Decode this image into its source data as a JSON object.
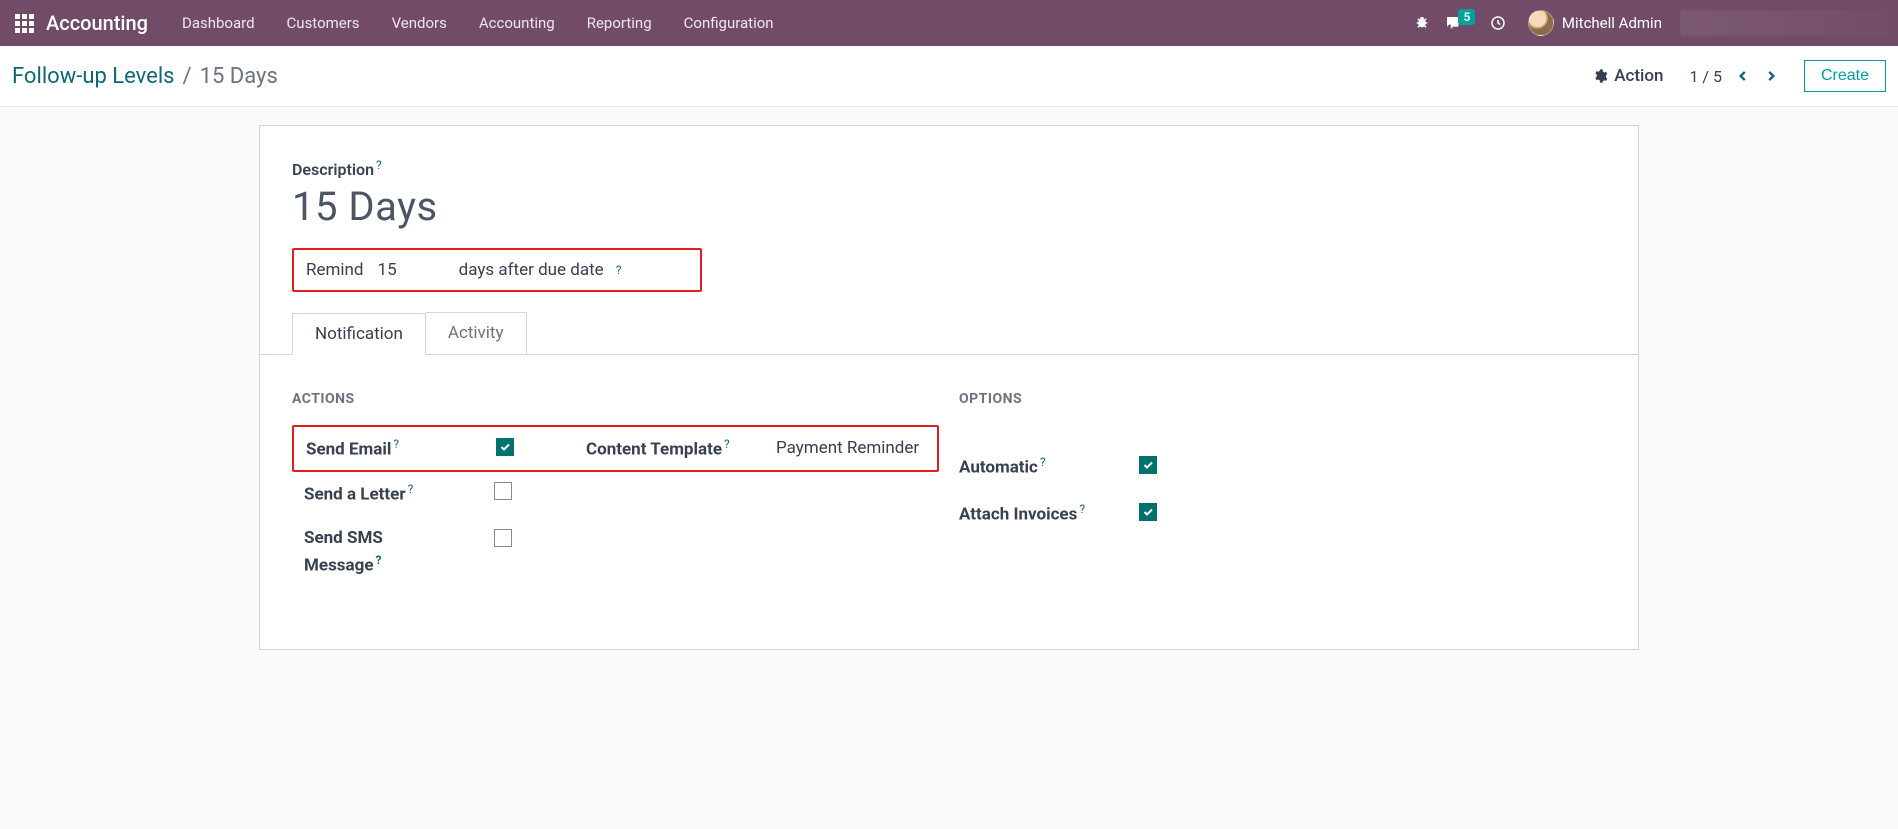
{
  "navbar": {
    "brand": "Accounting",
    "menu": [
      "Dashboard",
      "Customers",
      "Vendors",
      "Accounting",
      "Reporting",
      "Configuration"
    ],
    "msg_badge": "5",
    "user_name": "Mitchell Admin"
  },
  "controlbar": {
    "breadcrumb_root": "Follow-up Levels",
    "breadcrumb_sep": "/",
    "breadcrumb_current": "15 Days",
    "action_label": "Action",
    "pager": "1 / 5",
    "create_label": "Create"
  },
  "form": {
    "description_label": "Description",
    "description_value": "15 Days",
    "remind_label": "Remind",
    "remind_value": "15",
    "remind_suffix": "days after due date",
    "tabs": [
      "Notification",
      "Activity"
    ],
    "actions_legend": "ACTIONS",
    "options_legend": "OPTIONS",
    "actions": {
      "send_email_label": "Send Email",
      "send_email_checked": true,
      "content_template_label": "Content Template",
      "content_template_value": "Payment Reminder",
      "send_letter_label": "Send a Letter",
      "send_letter_checked": false,
      "send_sms_label_line1": "Send SMS",
      "send_sms_label_line2": "Message",
      "send_sms_checked": false
    },
    "options": {
      "automatic_label": "Automatic",
      "automatic_checked": true,
      "attach_invoices_label": "Attach Invoices",
      "attach_invoices_checked": true
    }
  }
}
